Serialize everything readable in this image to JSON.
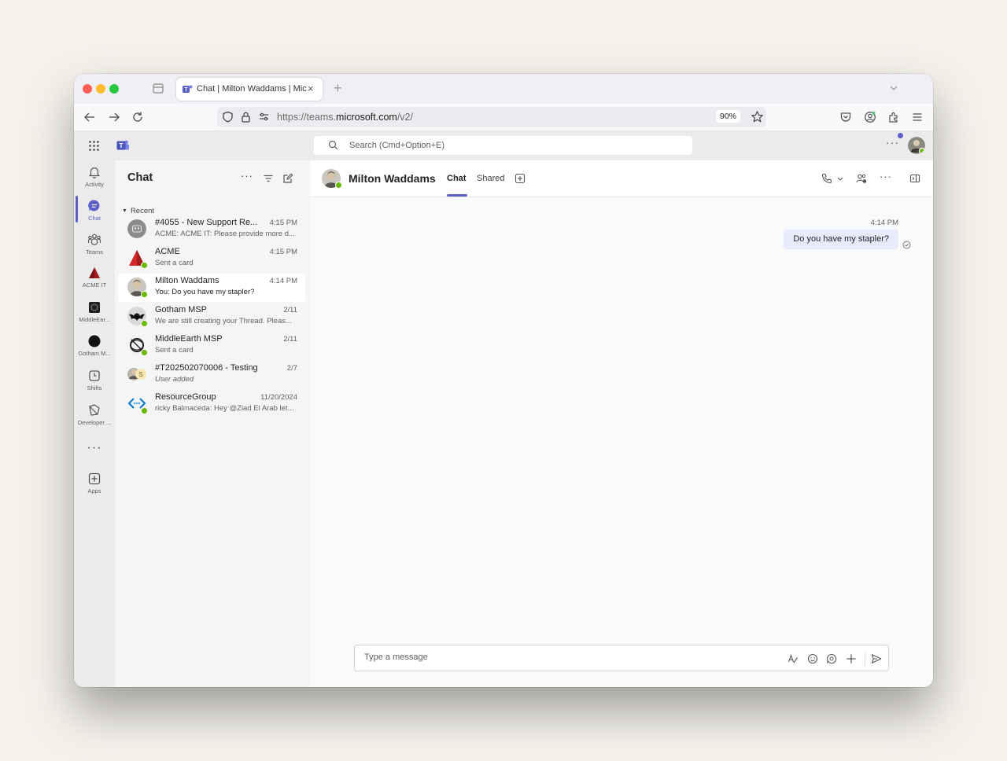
{
  "browser": {
    "tab_title": "Chat | Milton Waddams | Microsoft Teams",
    "close_glyph": "×",
    "new_tab_glyph": "+",
    "url_prefix": "https://teams.",
    "url_domain": "microsoft.com",
    "url_suffix": "/v2/",
    "zoom": "90%"
  },
  "teams_header": {
    "search_placeholder": "Search (Cmd+Option+E)",
    "more_glyph": "···"
  },
  "rail": {
    "items": [
      {
        "label": "Activity",
        "icon": "bell-icon"
      },
      {
        "label": "Chat",
        "icon": "chat-icon",
        "active": true
      },
      {
        "label": "Teams",
        "icon": "teams-icon"
      },
      {
        "label": "ACME IT",
        "icon": "acme-triangle-icon"
      },
      {
        "label": "MiddleEar...",
        "icon": "middleearth-app-icon"
      },
      {
        "label": "Gotham M...",
        "icon": "gotham-app-icon"
      },
      {
        "label": "Shifts",
        "icon": "shifts-icon"
      },
      {
        "label": "Developer ...",
        "icon": "developer-icon"
      },
      {
        "label": "Apps",
        "icon": "apps-icon"
      }
    ],
    "more_glyph": "···"
  },
  "chat_list": {
    "title": "Chat",
    "section": "Recent",
    "caret_glyph": "▼",
    "more_glyph": "···",
    "items": [
      {
        "name": "#4055 - New Support Re...",
        "time": "4:15 PM",
        "preview": "ACME: ACME IT: Please provide more d...",
        "avatar": "group-icon"
      },
      {
        "name": "ACME",
        "time": "4:15 PM",
        "preview": "Sent a card",
        "avatar": "acme-logo"
      },
      {
        "name": "Milton Waddams",
        "time": "4:14 PM",
        "preview": "You: Do you have my stapler?",
        "avatar": "milton-photo",
        "selected": true
      },
      {
        "name": "Gotham MSP",
        "time": "2/11",
        "preview": "We are still creating your Thread. Pleas...",
        "avatar": "batman-logo"
      },
      {
        "name": "MiddleEarth MSP",
        "time": "2/11",
        "preview": "Sent a card",
        "avatar": "ring-logo"
      },
      {
        "name": "#T202502070006 - Testing",
        "time": "2/7",
        "preview": "User added",
        "avatar": "group-photo",
        "italic": true
      },
      {
        "name": "ResourceGroup",
        "time": "11/20/2024",
        "preview": "ricky Balmaceda: Hey @Ziad El Arab let...",
        "avatar": "resource-group-logo"
      }
    ]
  },
  "conversation": {
    "contact_name": "Milton Waddams",
    "tabs": [
      "Chat",
      "Shared"
    ],
    "messages": [
      {
        "time": "4:14 PM",
        "text": "Do you have my stapler?"
      }
    ],
    "composer_placeholder": "Type a message",
    "more_glyph": "···"
  },
  "colors": {
    "accent": "#5b5fc7",
    "presence_available": "#6bb700",
    "own_bubble": "#e8ebfa"
  }
}
